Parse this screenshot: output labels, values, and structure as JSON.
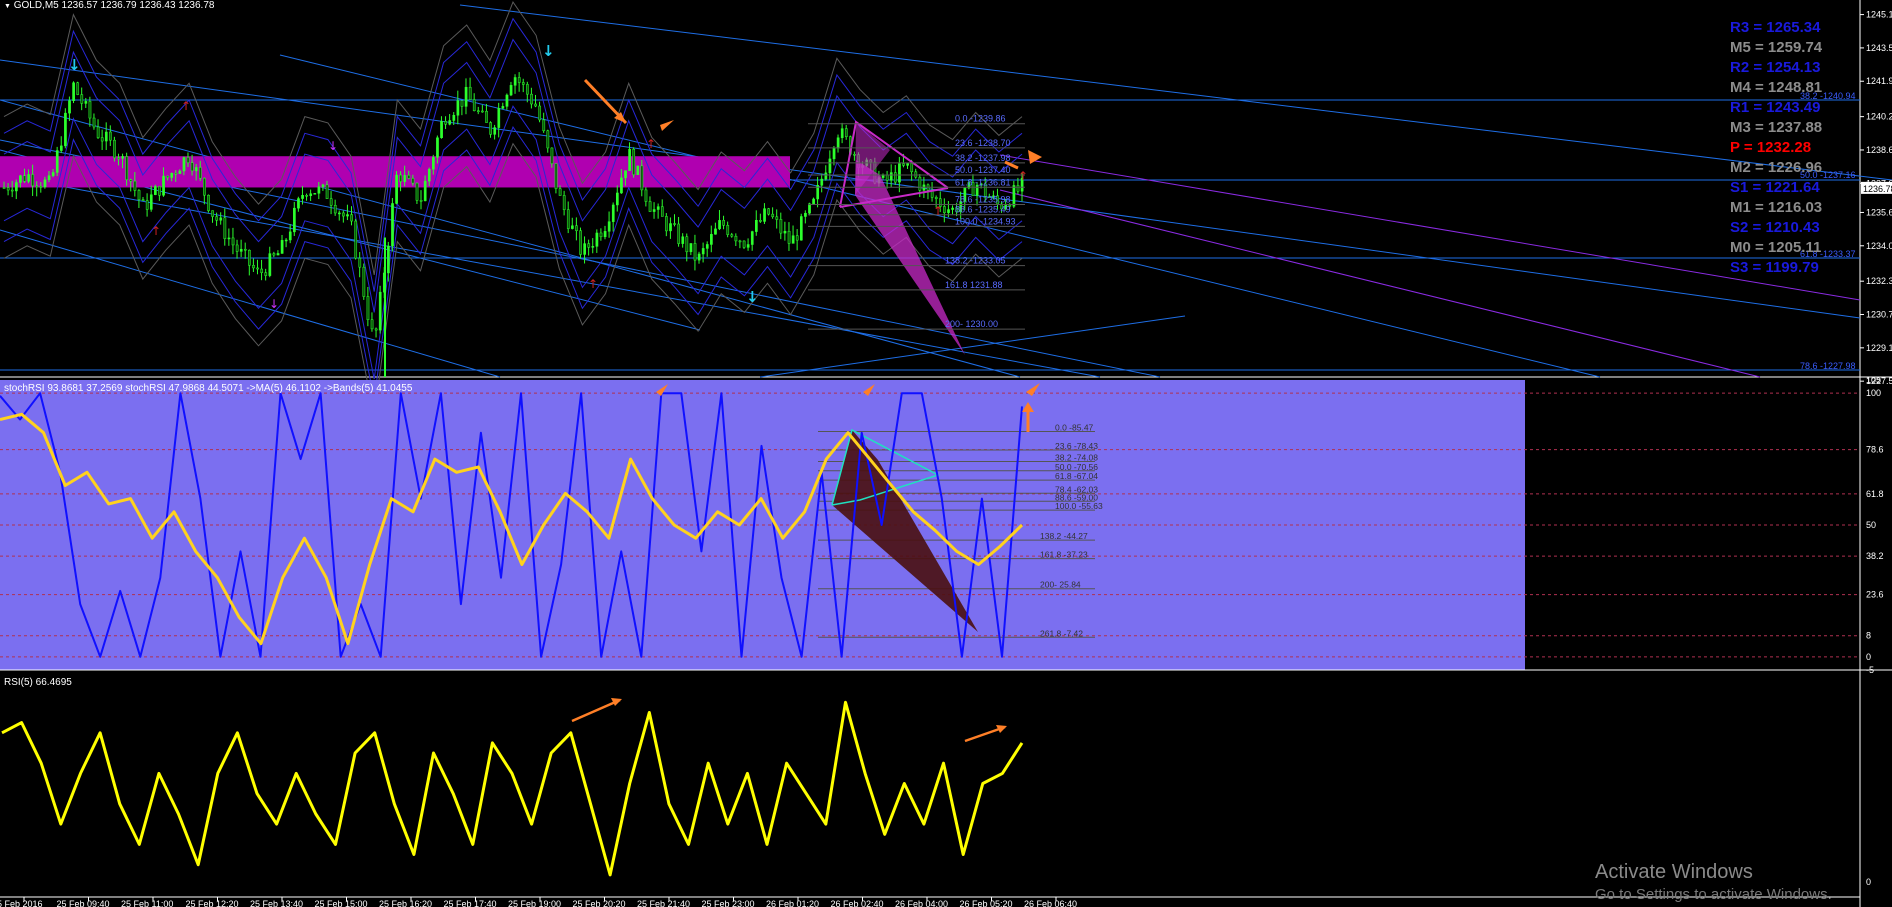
{
  "window": {
    "symbol_label": "GOLD,M5",
    "ohlc_text": "1236.57 1236.79 1236.43 1236.78"
  },
  "chart_data": [
    {
      "type": "candlestick",
      "title": "GOLD,M5",
      "ylim": [
        1227.7,
        1245.8
      ],
      "x": [
        "25 Feb 2016",
        "25 Feb 09:40",
        "25 Feb 11:00",
        "25 Feb 12:20",
        "25 Feb 13:40",
        "25 Feb 15:00",
        "25 Feb 16:20",
        "25 Feb 17:40",
        "25 Feb 19:00",
        "25 Feb 20:20",
        "25 Feb 21:40",
        "25 Feb 23:00",
        "26 Feb 01:20",
        "26 Feb 02:40",
        "26 Feb 04:00",
        "26 Feb 05:20",
        "26 Feb 06:40"
      ],
      "close_path": [
        1236.8,
        1237.4,
        1236.9,
        1241.7,
        1239.5,
        1238.4,
        1235.8,
        1237.2,
        1238.4,
        1235.6,
        1233.9,
        1232.6,
        1233.8,
        1236.8,
        1236.5,
        1234.9,
        1229.2,
        1237.6,
        1236.2,
        1240.2,
        1241.2,
        1239.5,
        1242.3,
        1240.7,
        1236.3,
        1233.6,
        1235.1,
        1238.4,
        1235.8,
        1234.6,
        1233.3,
        1235.1,
        1234.2,
        1235.6,
        1234.1,
        1236.0,
        1239.6,
        1238.1,
        1237.0,
        1237.8,
        1236.4,
        1235.7,
        1237.0,
        1235.9,
        1236.8
      ],
      "y_ticks": [
        1245.1,
        1243.5,
        1241.9,
        1240.2,
        1238.6,
        1237.0,
        1235.6,
        1234.0,
        1232.3,
        1230.7,
        1229.1,
        1227.5
      ],
      "current_price": "1236.78",
      "pivots": [
        {
          "name": "R3",
          "value": "1265.34",
          "color": "#1a1adc"
        },
        {
          "name": "M5",
          "value": "1259.74",
          "color": "#8c8c8c"
        },
        {
          "name": "R2",
          "value": "1254.13",
          "color": "#1a1adc"
        },
        {
          "name": "M4",
          "value": "1248.81",
          "color": "#8c8c8c"
        },
        {
          "name": "R1",
          "value": "1243.49",
          "color": "#1a1adc"
        },
        {
          "name": "M3",
          "value": "1237.88",
          "color": "#8c8c8c"
        },
        {
          "name": "P ",
          "value": "1232.28",
          "color": "#ff0000"
        },
        {
          "name": "M2",
          "value": "1226.96",
          "color": "#8c8c8c"
        },
        {
          "name": "S1",
          "value": "1221.64",
          "color": "#1a1adc"
        },
        {
          "name": "M1",
          "value": "1216.03",
          "color": "#8c8c8c"
        },
        {
          "name": "S2",
          "value": "1210.43",
          "color": "#1a1adc"
        },
        {
          "name": "M0",
          "value": "1205.11",
          "color": "#8c8c8c"
        },
        {
          "name": "S3",
          "value": "1199.79",
          "color": "#1a1adc"
        }
      ],
      "fib_levels": [
        {
          "label": "0.0 -1239.86",
          "value": 1239.86
        },
        {
          "label": "23.6 -1238.70",
          "value": 1238.7
        },
        {
          "label": "38.2 -1237.98",
          "value": 1237.98
        },
        {
          "label": "50.0 -1237.40",
          "value": 1237.4
        },
        {
          "label": "61.8 -1236.81",
          "value": 1236.81
        },
        {
          "label": "78.6 -1235.98",
          "value": 1235.98
        },
        {
          "label": "88.6 -1235.49",
          "value": 1235.49
        },
        {
          "label": "100.0 -1234.93",
          "value": 1234.93
        },
        {
          "label": "138.2 -1233.05",
          "value": 1233.05
        },
        {
          "label": "161.8 1231.88",
          "value": 1231.88
        },
        {
          "label": "200- 1230.00",
          "value": 1230.0
        }
      ],
      "fib_right_labels": [
        {
          "label": "38.2 -1240.94",
          "value": 1240.94
        },
        {
          "label": "50.0 -1237.16",
          "value": 1237.16
        },
        {
          "label": "61.8 -1233.37",
          "value": 1233.37
        },
        {
          "label": "78.6 -1227.98",
          "value": 1227.98
        }
      ],
      "colors": {
        "candles": "#2cff2c",
        "zone": "#b000b0",
        "pattern": "#c82ac8",
        "channel": "#1e6ee6",
        "bands": "#2828d8"
      }
    },
    {
      "type": "line",
      "title": "stochRSI 93.8681 37.2569 stochRSI 47.9868 44.5071 ->MA(5) 46.1102 ->Bands(5) 41.0455",
      "ylim": [
        -5,
        105
      ],
      "y_ticks": [
        105,
        100,
        78.6,
        61.8,
        50,
        38.2,
        23.6,
        8,
        0.0,
        -5
      ],
      "levels_dashed": [
        100,
        78.6,
        61.8,
        50,
        38.2,
        23.6,
        8,
        0
      ],
      "series": [
        {
          "name": "stochRSI",
          "color": "#1010ff",
          "values": [
            99,
            90,
            100,
            70,
            20,
            0,
            25,
            0,
            30,
            100,
            60,
            0,
            40,
            0,
            100,
            75,
            100,
            0,
            20,
            0,
            100,
            60,
            100,
            20,
            85,
            30,
            100,
            0,
            35,
            100,
            0,
            40,
            0,
            100,
            100,
            40,
            100,
            0,
            80,
            30,
            0,
            70,
            0,
            85,
            50,
            100,
            100,
            60,
            0,
            60,
            0,
            95
          ]
        },
        {
          "name": "MA(5)",
          "color": "#ffd21e",
          "values": [
            90,
            92,
            85,
            65,
            70,
            58,
            60,
            45,
            55,
            40,
            30,
            15,
            5,
            30,
            45,
            30,
            5,
            35,
            60,
            55,
            75,
            70,
            72,
            55,
            35,
            50,
            62,
            55,
            45,
            75,
            60,
            50,
            45,
            55,
            50,
            60,
            45,
            55,
            75,
            85,
            75,
            65,
            55,
            48,
            40,
            35,
            42,
            50
          ]
        }
      ],
      "fib_labels": [
        "0.0 -85.47",
        "23.6 -78.43",
        "38.2 -74.08",
        "50.0 -70.56",
        "61.8 -67.04",
        "78.4 -62.03",
        "88.6 -59.00",
        "100.0 -55.63",
        "138.2 -44.27",
        "161.8 -37.23",
        "200- 25.84",
        "261.8 -7.42"
      ],
      "fib_values": [
        85.47,
        78.43,
        74.08,
        70.56,
        67.04,
        62.03,
        59.0,
        55.63,
        44.27,
        37.23,
        25.84,
        7.42
      ],
      "colors": {
        "background": "#7b6ff0"
      }
    },
    {
      "type": "line",
      "title": "RSI(5) 66.4695",
      "series": [
        {
          "name": "RSI(5)",
          "color": "#ffff00",
          "values": [
            75,
            80,
            60,
            30,
            55,
            75,
            40,
            20,
            55,
            35,
            10,
            55,
            75,
            45,
            30,
            55,
            35,
            20,
            65,
            75,
            40,
            15,
            65,
            45,
            20,
            70,
            55,
            30,
            65,
            75,
            40,
            5,
            50,
            85,
            40,
            20,
            60,
            30,
            55,
            20,
            60,
            45,
            30,
            90,
            55,
            25,
            50,
            30,
            60,
            15,
            50,
            55,
            70
          ]
        }
      ]
    }
  ],
  "time_axis_labels": [
    "25 Feb 2016",
    "25 Feb 09:40",
    "25 Feb 11:00",
    "25 Feb 12:20",
    "25 Feb 13:40",
    "25 Feb 15:00",
    "25 Feb 16:20",
    "25 Feb 17:40",
    "25 Feb 19:00",
    "25 Feb 20:20",
    "25 Feb 21:40",
    "25 Feb 23:00",
    "26 Feb 01:20",
    "26 Feb 02:40",
    "26 Feb 04:00",
    "26 Feb 05:20",
    "26 Feb 06:40"
  ],
  "watermark": {
    "line1": "Activate Windows",
    "line2": "Go to Settings to activate Windows."
  }
}
